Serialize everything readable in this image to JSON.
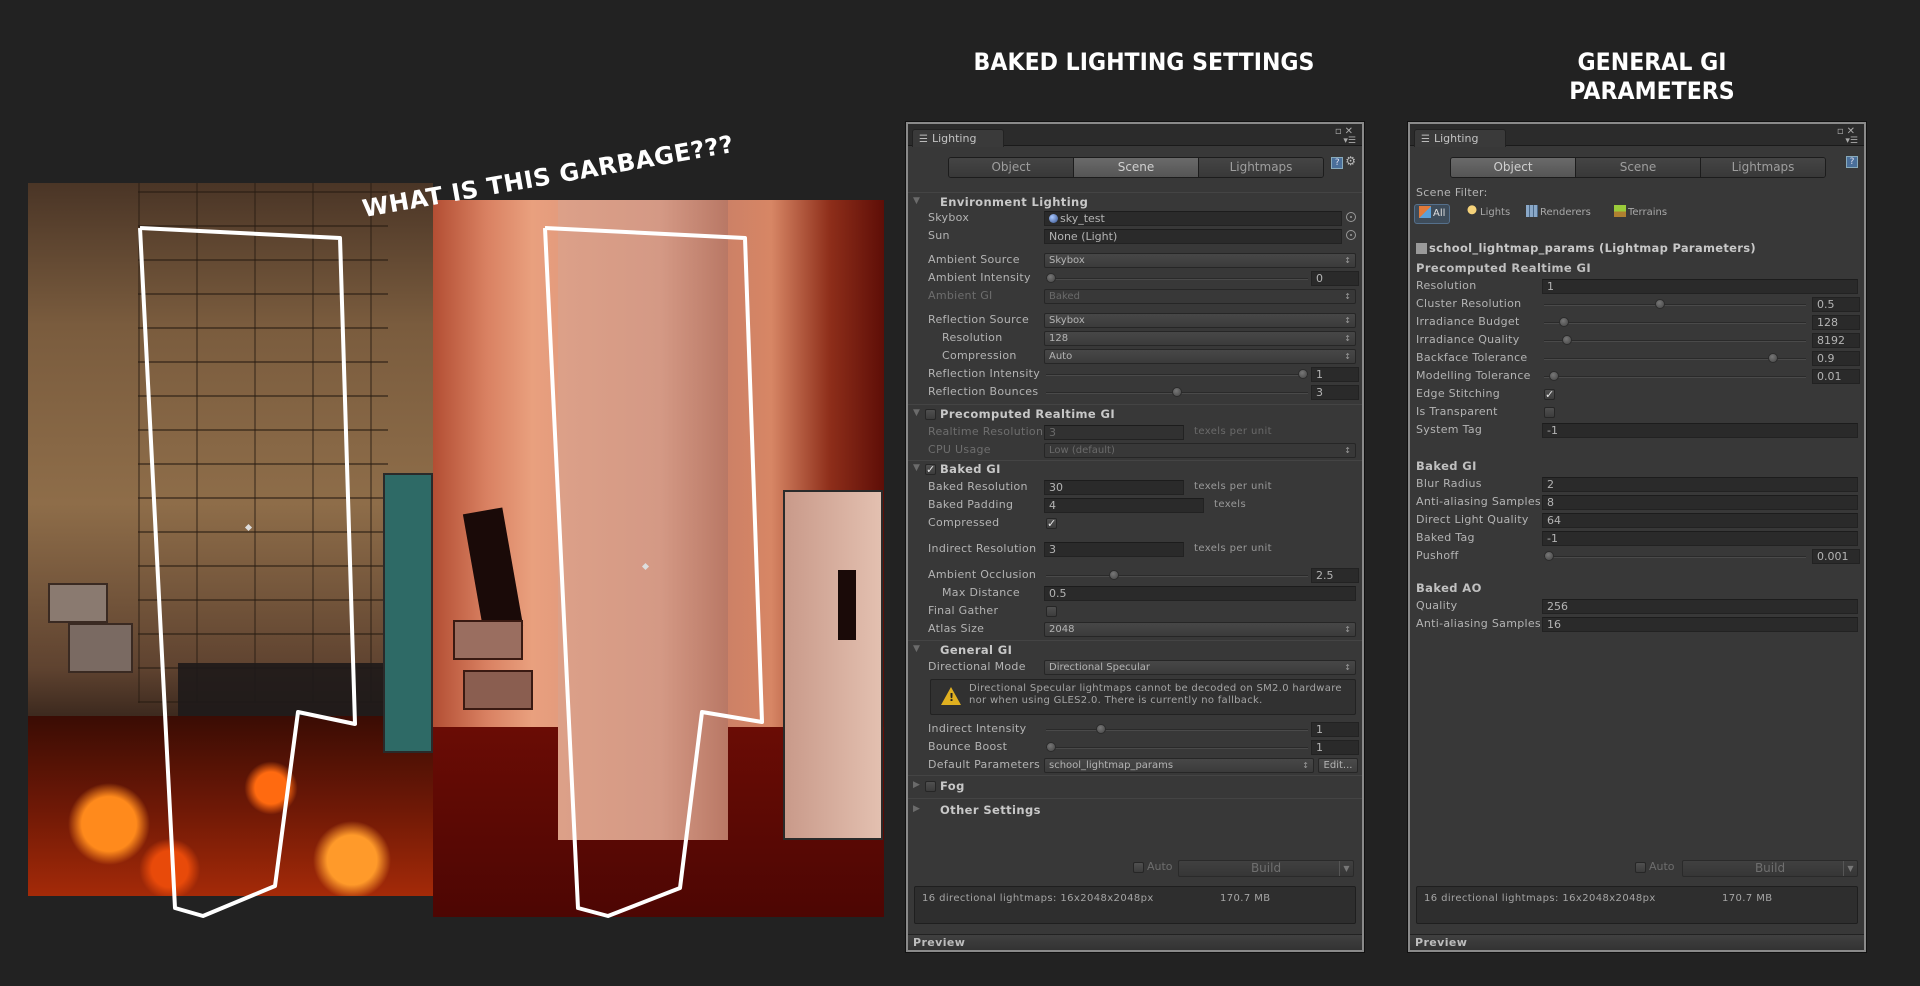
{
  "headings": {
    "left": "BAKED LIGHTING SETTINGS",
    "right_line1": "GENERAL GI",
    "right_line2": "PARAMETERS"
  },
  "annotation": "WHAT IS THIS GARBAGE???",
  "baked_panel": {
    "window_tab": "Lighting",
    "window_tab_icon": "sliders-icon",
    "mode_tabs": [
      {
        "label": "Object",
        "active": false
      },
      {
        "label": "Scene",
        "active": true
      },
      {
        "label": "Lightmaps",
        "active": false
      }
    ],
    "environment": {
      "title": "Environment Lighting",
      "skybox_label": "Skybox",
      "skybox_value": "sky_test",
      "sun_label": "Sun",
      "sun_value": "None (Light)",
      "ambient_source_label": "Ambient Source",
      "ambient_source_value": "Skybox",
      "ambient_intensity_label": "Ambient Intensity",
      "ambient_intensity_value": "0",
      "ambient_intensity_fraction": 0.0,
      "ambient_gi_label": "Ambient GI",
      "ambient_gi_value": "Baked",
      "reflection_source_label": "Reflection Source",
      "reflection_source_value": "Skybox",
      "resolution_label": "Resolution",
      "resolution_value": "128",
      "compression_label": "Compression",
      "compression_value": "Auto",
      "reflection_intensity_label": "Reflection Intensity",
      "reflection_intensity_value": "1",
      "reflection_intensity_fraction": 1.0,
      "reflection_bounces_label": "Reflection Bounces",
      "reflection_bounces_value": "3",
      "reflection_bounces_fraction": 0.5
    },
    "precomputed": {
      "title": "Precomputed Realtime GI",
      "enabled": false,
      "realtime_resolution_label": "Realtime Resolution",
      "realtime_resolution_value": "3",
      "realtime_resolution_unit": "texels per unit",
      "cpu_usage_label": "CPU Usage",
      "cpu_usage_value": "Low (default)"
    },
    "baked_gi": {
      "title": "Baked GI",
      "enabled": true,
      "baked_resolution_label": "Baked Resolution",
      "baked_resolution_value": "30",
      "baked_resolution_unit": "texels per unit",
      "baked_padding_label": "Baked Padding",
      "baked_padding_value": "4",
      "baked_padding_unit": "texels",
      "compressed_label": "Compressed",
      "compressed_checked": true,
      "indirect_resolution_label": "Indirect Resolution",
      "indirect_resolution_value": "3",
      "indirect_resolution_unit": "texels per unit",
      "ambient_occlusion_label": "Ambient Occlusion",
      "ambient_occlusion_value": "2.5",
      "ambient_occlusion_fraction": 0.25,
      "max_distance_label": "Max Distance",
      "max_distance_value": "0.5",
      "final_gather_label": "Final Gather",
      "final_gather_checked": false,
      "atlas_size_label": "Atlas Size",
      "atlas_size_value": "2048"
    },
    "general_gi": {
      "title": "General GI",
      "directional_mode_label": "Directional Mode",
      "directional_mode_value": "Directional Specular",
      "warning": "Directional Specular lightmaps cannot be decoded on SM2.0 hardware nor when using GLES2.0. There is currently no fallback.",
      "indirect_intensity_label": "Indirect Intensity",
      "indirect_intensity_value": "1",
      "indirect_intensity_fraction": 0.2,
      "bounce_boost_label": "Bounce Boost",
      "bounce_boost_value": "1",
      "bounce_boost_fraction": 0.0,
      "default_parameters_label": "Default Parameters",
      "default_parameters_value": "school_lightmap_params",
      "edit_label": "Edit..."
    },
    "fog": {
      "title": "Fog",
      "enabled": false
    },
    "other_settings": {
      "title": "Other Settings"
    },
    "auto_label": "Auto",
    "auto_checked": false,
    "build_label": "Build",
    "stats_text": "16 directional lightmaps: 16x2048x2048px",
    "stats_size": "170.7 MB",
    "preview_label": "Preview"
  },
  "params_panel": {
    "window_tab": "Lighting",
    "mode_tabs": [
      {
        "label": "Object",
        "active": true
      },
      {
        "label": "Scene",
        "active": false
      },
      {
        "label": "Lightmaps",
        "active": false
      }
    ],
    "scene_filter_label": "Scene Filter:",
    "filters": [
      {
        "label": "All",
        "icon": "cube-icon",
        "active": true
      },
      {
        "label": "Lights",
        "icon": "lightbulb-icon",
        "active": false
      },
      {
        "label": "Renderers",
        "icon": "renderer-icon",
        "active": false
      },
      {
        "label": "Terrains",
        "icon": "terrain-icon",
        "active": false
      }
    ],
    "asset_title": "school_lightmap_params (Lightmap Parameters)",
    "precomputed": {
      "title": "Precomputed Realtime GI",
      "resolution_label": "Resolution",
      "resolution_value": "1",
      "cluster_resolution_label": "Cluster Resolution",
      "cluster_resolution_value": "0.5",
      "cluster_resolution_fraction": 0.44,
      "irradiance_budget_label": "Irradiance Budget",
      "irradiance_budget_value": "128",
      "irradiance_budget_fraction": 0.06,
      "irradiance_quality_label": "Irradiance Quality",
      "irradiance_quality_value": "8192",
      "irradiance_quality_fraction": 0.07,
      "backface_tolerance_label": "Backface Tolerance",
      "backface_tolerance_value": "0.9",
      "backface_tolerance_fraction": 0.89,
      "modelling_tolerance_label": "Modelling Tolerance",
      "modelling_tolerance_value": "0.01",
      "modelling_tolerance_fraction": 0.02,
      "edge_stitching_label": "Edge Stitching",
      "edge_stitching_checked": true,
      "is_transparent_label": "Is Transparent",
      "is_transparent_checked": false,
      "system_tag_label": "System Tag",
      "system_tag_value": "-1"
    },
    "baked_gi": {
      "title": "Baked GI",
      "blur_radius_label": "Blur Radius",
      "blur_radius_value": "2",
      "aa_samples_label": "Anti-aliasing Samples",
      "aa_samples_value": "8",
      "direct_light_quality_label": "Direct Light Quality",
      "direct_light_quality_value": "64",
      "baked_tag_label": "Baked Tag",
      "baked_tag_value": "-1",
      "pushoff_label": "Pushoff",
      "pushoff_value": "0.001",
      "pushoff_fraction": 0.0
    },
    "baked_ao": {
      "title": "Baked AO",
      "quality_label": "Quality",
      "quality_value": "256",
      "aa_samples_label": "Anti-aliasing Samples",
      "aa_samples_value": "16"
    },
    "auto_label": "Auto",
    "auto_checked": false,
    "build_label": "Build",
    "stats_text": "16 directional lightmaps: 16x2048x2048px",
    "stats_size": "170.7 MB",
    "preview_label": "Preview"
  }
}
